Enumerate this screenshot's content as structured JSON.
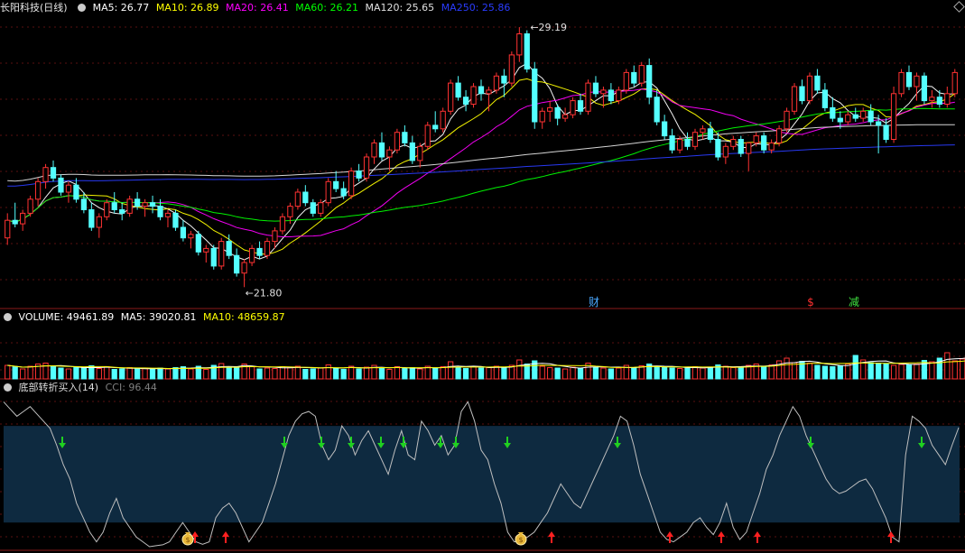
{
  "main_legend": {
    "stock_name": "长阳科技(日线)",
    "items": [
      {
        "label": "MA5: 26.77",
        "color": "#ffffff"
      },
      {
        "label": "MA10: 26.89",
        "color": "#ffff00"
      },
      {
        "label": "MA20: 26.41",
        "color": "#ff00ff"
      },
      {
        "label": "MA60: 26.21",
        "color": "#00ff00"
      },
      {
        "label": "MA120: 25.65",
        "color": "#e0e0e0"
      },
      {
        "label": "MA250: 25.86",
        "color": "#2a3cff"
      }
    ]
  },
  "volume_legend": {
    "items": [
      {
        "label": "VOLUME: 49461.89",
        "color": "#ffffff"
      },
      {
        "label": "MA5: 39020.81",
        "color": "#ffffff"
      },
      {
        "label": "MA10: 48659.87",
        "color": "#ffff00"
      }
    ]
  },
  "indicator_legend": {
    "name": "底部转折买入(14)",
    "items": [
      {
        "label": "CCI: 96.44",
        "color": "#808080"
      }
    ]
  },
  "annotations": {
    "high_price": "29.19",
    "low_price": "21.80",
    "event_markers": [
      {
        "text": "财",
        "color": "#4aa8ff"
      },
      {
        "text": "$",
        "color": "#ff3030"
      },
      {
        "text": "减",
        "color": "#40e040"
      }
    ]
  },
  "colors": {
    "up": "#ff3232",
    "down": "#54ffff",
    "band": "#0e2a40",
    "cci": "#bfbfbf",
    "buy_arrow": "#ff2020",
    "sell_arrow": "#20d020"
  },
  "icons": {
    "buy_signal": "red-up-arrow",
    "sell_signal": "green-down-arrow",
    "bottom_signal": "money-bag-icon"
  },
  "chart_data": [
    {
      "type": "candlestick",
      "title": "长阳科技(日线)",
      "ylim": [
        21.5,
        29.5
      ],
      "highest": 29.19,
      "lowest": 21.8,
      "ohlc": [
        [
          23.2,
          23.9,
          23.0,
          23.7
        ],
        [
          23.7,
          24.2,
          23.5,
          23.6
        ],
        [
          23.6,
          24.0,
          23.4,
          23.9
        ],
        [
          23.9,
          24.4,
          23.8,
          24.3
        ],
        [
          24.3,
          24.9,
          24.1,
          24.8
        ],
        [
          24.8,
          25.3,
          24.6,
          25.2
        ],
        [
          25.2,
          25.4,
          24.8,
          24.9
        ],
        [
          24.9,
          25.0,
          24.4,
          24.5
        ],
        [
          24.5,
          24.8,
          24.2,
          24.7
        ],
        [
          24.7,
          24.9,
          24.2,
          24.3
        ],
        [
          24.3,
          24.5,
          23.9,
          24.0
        ],
        [
          24.0,
          24.2,
          23.4,
          23.5
        ],
        [
          23.5,
          23.9,
          23.2,
          23.8
        ],
        [
          23.8,
          24.3,
          23.7,
          24.2
        ],
        [
          24.2,
          24.5,
          23.9,
          24.0
        ],
        [
          24.0,
          24.2,
          23.7,
          23.9
        ],
        [
          23.9,
          24.4,
          23.8,
          24.3
        ],
        [
          24.3,
          24.5,
          24.0,
          24.1
        ],
        [
          24.1,
          24.3,
          23.8,
          24.2
        ],
        [
          24.2,
          24.4,
          23.9,
          24.1
        ],
        [
          24.1,
          24.3,
          23.7,
          23.8
        ],
        [
          23.8,
          24.0,
          23.5,
          23.9
        ],
        [
          23.9,
          24.0,
          23.4,
          23.5
        ],
        [
          23.5,
          23.7,
          23.1,
          23.2
        ],
        [
          23.2,
          23.4,
          22.9,
          23.3
        ],
        [
          23.3,
          23.4,
          22.7,
          22.8
        ],
        [
          22.8,
          23.0,
          22.5,
          22.9
        ],
        [
          22.9,
          23.0,
          22.3,
          22.4
        ],
        [
          22.4,
          23.2,
          22.3,
          23.1
        ],
        [
          23.1,
          23.3,
          22.6,
          22.7
        ],
        [
          22.7,
          22.9,
          22.1,
          22.2
        ],
        [
          22.2,
          22.6,
          21.8,
          22.5
        ],
        [
          22.5,
          23.0,
          22.4,
          22.9
        ],
        [
          22.9,
          23.1,
          22.6,
          22.7
        ],
        [
          22.7,
          23.2,
          22.6,
          23.1
        ],
        [
          23.1,
          23.5,
          22.9,
          23.4
        ],
        [
          23.4,
          23.9,
          23.3,
          23.8
        ],
        [
          23.8,
          24.2,
          23.6,
          24.1
        ],
        [
          24.1,
          24.6,
          24.0,
          24.5
        ],
        [
          24.5,
          24.7,
          24.1,
          24.2
        ],
        [
          24.2,
          24.3,
          23.8,
          23.9
        ],
        [
          23.9,
          24.3,
          23.8,
          24.2
        ],
        [
          24.2,
          24.9,
          24.1,
          24.8
        ],
        [
          24.8,
          25.1,
          24.5,
          24.6
        ],
        [
          24.6,
          24.8,
          24.3,
          24.4
        ],
        [
          24.4,
          25.2,
          24.3,
          25.1
        ],
        [
          25.1,
          25.3,
          24.8,
          24.9
        ],
        [
          24.9,
          25.6,
          24.8,
          25.5
        ],
        [
          25.5,
          26.0,
          25.3,
          25.9
        ],
        [
          25.9,
          26.2,
          25.4,
          25.5
        ],
        [
          25.5,
          25.8,
          25.1,
          25.7
        ],
        [
          25.7,
          26.3,
          25.6,
          26.2
        ],
        [
          26.2,
          26.4,
          25.8,
          25.9
        ],
        [
          25.9,
          26.1,
          25.3,
          25.4
        ],
        [
          25.4,
          25.9,
          25.2,
          25.8
        ],
        [
          25.8,
          26.5,
          25.7,
          26.4
        ],
        [
          26.4,
          26.8,
          26.2,
          26.3
        ],
        [
          26.3,
          26.9,
          26.2,
          26.8
        ],
        [
          26.8,
          27.7,
          26.7,
          27.6
        ],
        [
          27.6,
          27.8,
          27.1,
          27.2
        ],
        [
          27.2,
          27.4,
          26.8,
          27.0
        ],
        [
          27.0,
          27.6,
          26.9,
          27.5
        ],
        [
          27.5,
          27.7,
          27.1,
          27.3
        ],
        [
          27.3,
          27.5,
          26.8,
          27.4
        ],
        [
          27.4,
          27.9,
          27.3,
          27.8
        ],
        [
          27.8,
          28.0,
          27.2,
          27.6
        ],
        [
          27.6,
          28.5,
          27.5,
          28.4
        ],
        [
          28.4,
          29.19,
          28.2,
          29.0
        ],
        [
          29.0,
          29.1,
          27.9,
          28.0
        ],
        [
          28.0,
          28.2,
          26.3,
          26.5
        ],
        [
          26.5,
          26.9,
          26.3,
          26.8
        ],
        [
          26.8,
          27.1,
          26.5,
          26.9
        ],
        [
          26.9,
          27.0,
          26.4,
          26.6
        ],
        [
          26.6,
          26.9,
          26.5,
          26.7
        ],
        [
          26.7,
          27.2,
          26.6,
          27.1
        ],
        [
          27.1,
          27.3,
          26.7,
          26.8
        ],
        [
          26.8,
          27.7,
          26.7,
          27.6
        ],
        [
          27.6,
          27.8,
          27.2,
          27.3
        ],
        [
          27.3,
          27.5,
          26.9,
          27.4
        ],
        [
          27.4,
          27.6,
          27.0,
          27.1
        ],
        [
          27.1,
          27.5,
          27.0,
          27.4
        ],
        [
          27.4,
          28.0,
          27.3,
          27.9
        ],
        [
          27.9,
          28.1,
          27.5,
          27.6
        ],
        [
          27.6,
          28.2,
          27.5,
          28.1
        ],
        [
          28.1,
          28.3,
          27.0,
          27.2
        ],
        [
          27.2,
          27.4,
          26.4,
          26.5
        ],
        [
          26.5,
          26.7,
          26.0,
          26.1
        ],
        [
          26.1,
          26.3,
          25.6,
          25.7
        ],
        [
          25.7,
          26.1,
          25.6,
          26.0
        ],
        [
          26.0,
          26.2,
          25.7,
          25.8
        ],
        [
          25.8,
          26.3,
          25.7,
          26.2
        ],
        [
          26.2,
          26.4,
          26.0,
          26.3
        ],
        [
          26.3,
          26.5,
          25.9,
          26.0
        ],
        [
          26.0,
          26.2,
          25.4,
          25.5
        ],
        [
          25.5,
          25.9,
          25.3,
          25.8
        ],
        [
          25.8,
          26.1,
          25.7,
          26.0
        ],
        [
          26.0,
          26.1,
          25.5,
          25.6
        ],
        [
          25.6,
          25.8,
          25.1,
          25.9
        ],
        [
          25.9,
          26.2,
          25.8,
          26.1
        ],
        [
          26.1,
          26.2,
          25.6,
          25.7
        ],
        [
          25.7,
          26.0,
          25.6,
          25.9
        ],
        [
          25.9,
          26.4,
          25.8,
          26.3
        ],
        [
          26.3,
          26.9,
          26.2,
          26.8
        ],
        [
          26.8,
          27.6,
          26.7,
          27.5
        ],
        [
          27.5,
          27.7,
          27.0,
          27.1
        ],
        [
          27.1,
          27.9,
          27.0,
          27.8
        ],
        [
          27.8,
          28.0,
          27.3,
          27.4
        ],
        [
          27.4,
          27.6,
          26.8,
          26.9
        ],
        [
          26.9,
          27.2,
          26.5,
          26.6
        ],
        [
          26.6,
          26.8,
          26.3,
          26.5
        ],
        [
          26.5,
          26.8,
          26.4,
          26.7
        ],
        [
          26.7,
          26.9,
          26.5,
          26.6
        ],
        [
          26.6,
          26.9,
          26.5,
          26.8
        ],
        [
          26.8,
          27.0,
          26.4,
          26.5
        ],
        [
          26.5,
          26.7,
          25.6,
          26.4
        ],
        [
          26.4,
          26.6,
          25.9,
          26.0
        ],
        [
          26.0,
          27.5,
          25.9,
          27.3
        ],
        [
          27.3,
          28.0,
          27.2,
          27.9
        ],
        [
          27.9,
          28.1,
          27.4,
          27.5
        ],
        [
          27.5,
          27.9,
          27.1,
          27.8
        ],
        [
          27.8,
          27.9,
          27.0,
          27.1
        ],
        [
          27.1,
          27.4,
          26.9,
          27.2
        ],
        [
          27.2,
          27.4,
          26.9,
          27.0
        ],
        [
          27.0,
          27.5,
          26.9,
          27.3
        ],
        [
          27.3,
          28.0,
          27.2,
          27.9
        ]
      ],
      "series": [
        {
          "name": "MA5",
          "values": []
        },
        {
          "name": "MA10",
          "values": []
        },
        {
          "name": "MA20",
          "values": []
        },
        {
          "name": "MA60",
          "values": []
        },
        {
          "name": "MA120",
          "values": []
        },
        {
          "name": "MA250",
          "values": []
        }
      ]
    },
    {
      "type": "bar",
      "title": "VOLUME",
      "ylim": [
        0,
        120000
      ],
      "values": [
        30000,
        26000,
        22000,
        28000,
        33000,
        35000,
        27000,
        24000,
        22000,
        26000,
        25000,
        29000,
        23000,
        27000,
        21000,
        22000,
        25000,
        22000,
        23000,
        21000,
        24000,
        22000,
        25000,
        27000,
        22000,
        28000,
        21000,
        30000,
        34000,
        24000,
        26000,
        33000,
        27000,
        22000,
        24000,
        23000,
        27000,
        26000,
        28000,
        21000,
        22000,
        24000,
        31000,
        23000,
        21000,
        28000,
        22000,
        26000,
        30000,
        23000,
        21000,
        27000,
        24000,
        25000,
        22000,
        28000,
        23000,
        27000,
        38000,
        26000,
        23000,
        27000,
        24000,
        25000,
        28000,
        24000,
        30000,
        42000,
        33000,
        40000,
        28000,
        25000,
        24000,
        22000,
        26000,
        23000,
        35000,
        26000,
        24000,
        22000,
        24000,
        30000,
        25000,
        29000,
        33000,
        27000,
        26000,
        24000,
        23000,
        25000,
        27000,
        24000,
        26000,
        31000,
        28000,
        25000,
        26000,
        30000,
        33000,
        27000,
        31000,
        40000,
        46000,
        36000,
        39000,
        35000,
        30000,
        28000,
        27000,
        29000,
        33000,
        52000,
        42000,
        36000,
        35000,
        34000,
        30000,
        32000,
        31000,
        33000,
        41000,
        38000,
        46000,
        58000,
        40000,
        44000,
        49462
      ],
      "series": [
        {
          "name": "MA5",
          "values": []
        },
        {
          "name": "MA10",
          "values": []
        }
      ]
    },
    {
      "type": "line",
      "title": "底部转折买入(14)",
      "ylim": [
        -150,
        160
      ],
      "band": [
        -100,
        100
      ],
      "series": [
        {
          "name": "CCI",
          "values": [
            150,
            135,
            120,
            130,
            140,
            125,
            110,
            95,
            60,
            20,
            -10,
            -60,
            -90,
            -120,
            -140,
            -120,
            -80,
            -50,
            -90,
            -110,
            -130,
            -140,
            -150,
            -148,
            -146,
            -140,
            -120,
            -100,
            -120,
            -140,
            -145,
            -140,
            -90,
            -70,
            -60,
            -80,
            -110,
            -140,
            -120,
            -100,
            -60,
            -20,
            30,
            80,
            110,
            125,
            130,
            120,
            60,
            30,
            50,
            100,
            80,
            40,
            70,
            90,
            60,
            30,
            0,
            50,
            90,
            40,
            30,
            110,
            90,
            60,
            80,
            40,
            60,
            130,
            150,
            110,
            50,
            30,
            -20,
            -60,
            -120,
            -140,
            -138,
            -130,
            -120,
            -100,
            -80,
            -50,
            -20,
            -40,
            -60,
            -70,
            -40,
            -10,
            20,
            50,
            80,
            120,
            110,
            60,
            0,
            -40,
            -80,
            -120,
            -135,
            -140,
            -130,
            -120,
            -100,
            -90,
            -110,
            -125,
            -100,
            -60,
            -110,
            -135,
            -120,
            -80,
            -40,
            10,
            40,
            80,
            110,
            140,
            120,
            80,
            50,
            20,
            -10,
            -30,
            -40,
            -35,
            -25,
            -15,
            -10,
            -30,
            -60,
            -90,
            -130,
            -140,
            40,
            120,
            110,
            95,
            60,
            40,
            20,
            60,
            96.44
          ]
        }
      ],
      "buy_signals": [
        25,
        29,
        69,
        76,
        88,
        93,
        97,
        114,
        119
      ],
      "sell_signals": [
        6,
        28,
        33,
        37,
        38,
        42,
        47,
        57,
        63,
        65,
        79,
        96,
        114,
        126
      ],
      "bottom_signals": [
        23,
        63
      ]
    }
  ]
}
